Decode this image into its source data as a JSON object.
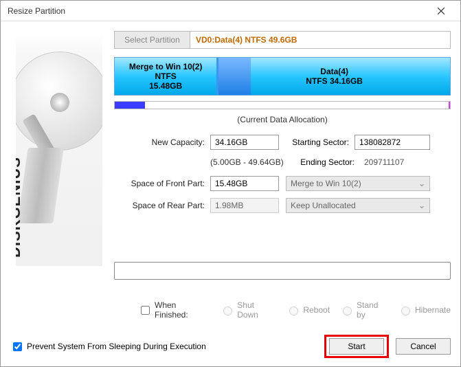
{
  "window": {
    "title": "Resize Partition"
  },
  "select_partition": {
    "button_label": "Select Partition",
    "value": "VD0:Data(4) NTFS 49.6GB"
  },
  "partitions": {
    "left": {
      "name": "Merge to Win 10(2)",
      "fs": "NTFS",
      "size": "15.48GB"
    },
    "right": {
      "name": "Data(4)",
      "fs_size": "NTFS 34.16GB"
    }
  },
  "allocation_caption": "(Current Data Allocation)",
  "form": {
    "new_capacity_label": "New Capacity:",
    "new_capacity_value": "34.16GB",
    "capacity_range": "(5.00GB - 49.64GB)",
    "starting_sector_label": "Starting Sector:",
    "starting_sector_value": "138082872",
    "ending_sector_label": "Ending Sector:",
    "ending_sector_value": "209711107",
    "front_part_label": "Space of Front Part:",
    "front_part_value": "15.48GB",
    "front_part_target": "Merge to Win 10(2)",
    "rear_part_label": "Space of Rear Part:",
    "rear_part_value": "1.98MB",
    "rear_part_target": "Keep Unallocated"
  },
  "when_finished": {
    "label": "When Finished:",
    "options": {
      "shutdown": "Shut Down",
      "reboot": "Reboot",
      "standby": "Stand by",
      "hibernate": "Hibernate"
    }
  },
  "prevent_sleep_label": "Prevent System From Sleeping During Execution",
  "buttons": {
    "start": "Start",
    "cancel": "Cancel"
  },
  "brand": "DISKGENIUS"
}
